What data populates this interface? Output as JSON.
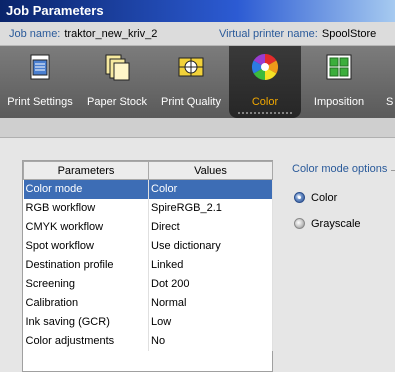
{
  "window": {
    "title": "Job Parameters"
  },
  "info": {
    "job_label": "Job name:",
    "job_value": "traktor_new_kriv_2",
    "printer_label": "Virtual printer name:",
    "printer_value": "SpoolStore"
  },
  "toolbar": {
    "tabs": [
      {
        "label": "Print Settings",
        "icon": "print-settings-icon"
      },
      {
        "label": "Paper Stock",
        "icon": "paper-stock-icon"
      },
      {
        "label": "Print Quality",
        "icon": "print-quality-icon"
      },
      {
        "label": "Color",
        "icon": "color-wheel-icon",
        "active": true
      },
      {
        "label": "Imposition",
        "icon": "imposition-icon"
      },
      {
        "label": "S",
        "icon": "partial-tab"
      }
    ]
  },
  "grid": {
    "headers": [
      "Parameters",
      "Values"
    ],
    "rows": [
      [
        "Color mode",
        "Color"
      ],
      [
        "RGB workflow",
        "SpireRGB_2.1"
      ],
      [
        "CMYK workflow",
        "Direct"
      ],
      [
        "Spot workflow",
        "Use dictionary"
      ],
      [
        "Destination profile",
        "Linked"
      ],
      [
        "Screening",
        "Dot 200"
      ],
      [
        "Calibration",
        "Normal"
      ],
      [
        "Ink saving (GCR)",
        "Low"
      ],
      [
        "Color adjustments",
        "No"
      ]
    ],
    "selected_row": 0
  },
  "options": {
    "title": "Color mode options",
    "radios": [
      {
        "label": "Color",
        "checked": true
      },
      {
        "label": "Grayscale",
        "checked": false
      }
    ]
  },
  "colors": {
    "accent": "#f2a800",
    "selection": "#3d6db5",
    "label_blue": "#2a5a9a"
  }
}
